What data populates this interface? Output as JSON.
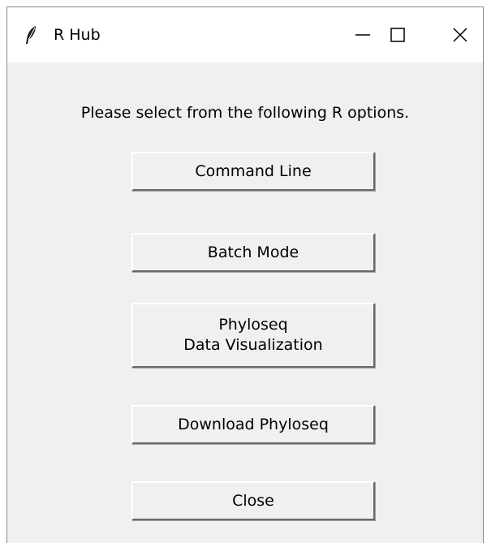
{
  "window": {
    "title": "R Hub",
    "app_icon": "feather-icon",
    "controls": [
      "minimize-icon",
      "maximize-icon",
      "close-icon"
    ]
  },
  "main": {
    "prompt": "Please select from the following R options.",
    "buttons": {
      "command_line": "Command Line",
      "batch_mode": "Batch Mode",
      "phyloseq_line1": "Phyloseq",
      "phyloseq_line2": "Data Visualization",
      "download_phyloseq": "Download Phyloseq",
      "close": "Close"
    }
  },
  "colors": {
    "window_background": "#f0f0f0",
    "titlebar_background": "#ffffff"
  }
}
